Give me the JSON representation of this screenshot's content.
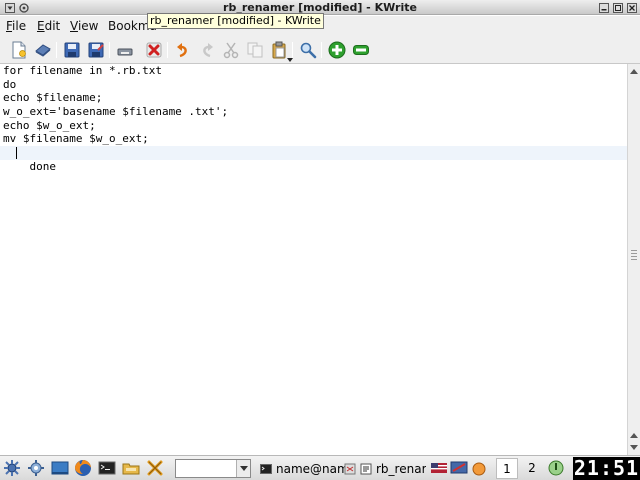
{
  "window": {
    "title": "rb_renamer [modified] - KWrite"
  },
  "tooltip": {
    "text": "rb_renamer [modified] - KWrite"
  },
  "menubar": {
    "items": [
      {
        "mnemonic": "F",
        "rest": "ile"
      },
      {
        "mnemonic": "E",
        "rest": "dit"
      },
      {
        "mnemonic": "V",
        "rest": "iew"
      },
      {
        "mnemonic": "",
        "rest": "Bookma"
      }
    ]
  },
  "toolbar": {
    "icons": [
      "new-document",
      "open-folder",
      "save",
      "save-as",
      "close",
      "close-red-x",
      "undo",
      "redo",
      "cut",
      "copy",
      "paste",
      "find",
      "zoom-in",
      "zoom-out"
    ],
    "colors": {
      "add": "#2ea02e",
      "close": "#d02020",
      "undo": "#e07010"
    }
  },
  "editor": {
    "lines": [
      "for filename in *.rb.txt",
      "do",
      "echo $filename;",
      "w_o_ext='basename $filename .txt';",
      "echo $w_o_ext;",
      "mv $filename $w_o_ext;",
      "done"
    ],
    "current_line_index": 6
  },
  "taskbar": {
    "tasks": [
      "name@nam",
      "rb_renar"
    ],
    "desktops": [
      "1",
      "2"
    ],
    "active_desktop": "1",
    "clock": "21:51"
  }
}
